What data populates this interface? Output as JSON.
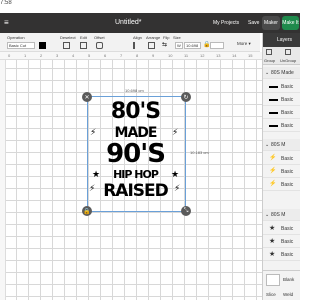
{
  "corner": "7:58",
  "topbar": {
    "title": "Untitled*",
    "my_projects": "My Projects",
    "save": "Save",
    "machine": "Maker",
    "make": "Make It"
  },
  "toolbar": {
    "operation_label": "Operation",
    "operation_value": "Basic Cut",
    "deselect": "Deselect",
    "edit": "Edit",
    "offset": "Offset",
    "align": "Align",
    "arrange": "Arrange",
    "flip": "Flip",
    "size": "Size",
    "size_w": "10.698",
    "more": "More ▾"
  },
  "ruler_ticks": [
    "0",
    "1",
    "2",
    "3",
    "4",
    "5",
    "6",
    "7",
    "8",
    "9",
    "10",
    "11",
    "12",
    "13",
    "14",
    "15"
  ],
  "canvas": {
    "width_label": "10.698 cm",
    "height_label": "10.183 cm"
  },
  "artwork": {
    "line1": "80'S",
    "line2": "MADE",
    "line3": "90'S",
    "line4": "HIP HOP",
    "line5": "RAISED"
  },
  "layers_panel": {
    "tab": "Layers",
    "group_btn": "Group",
    "ungroup_btn": "UnGroup",
    "groups": [
      {
        "title": "80S Made",
        "items": [
          "Basic",
          "Basic",
          "Basic",
          "Basic"
        ]
      },
      {
        "title": "80S M",
        "items": [
          "Basic",
          "Basic",
          "Basic"
        ]
      },
      {
        "title": "80S M",
        "items": [
          "Basic",
          "Basic",
          "Basic"
        ]
      }
    ],
    "blank_canvas": "Blank",
    "slice": "Slice",
    "weld": "Weld"
  },
  "colors": {
    "topbar": "#333232",
    "accent": "#1f8a4c",
    "selection": "#6aa0d8"
  }
}
